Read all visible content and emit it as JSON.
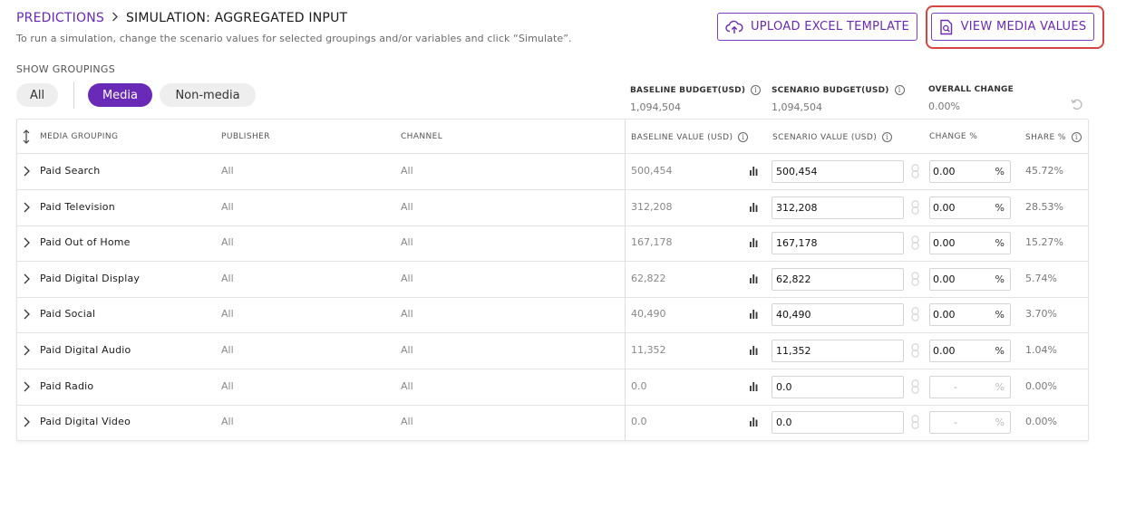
{
  "header": {
    "breadcrumb_root": "PREDICTIONS",
    "breadcrumb_current": "SIMULATION: AGGREGATED INPUT",
    "subtitle": "To run a simulation, change the scenario values for selected groupings and/or variables and click “Simulate”.",
    "upload_label": "UPLOAD EXCEL TEMPLATE",
    "view_label": "VIEW MEDIA VALUES"
  },
  "groupings": {
    "label": "SHOW GROUPINGS",
    "options": [
      "All",
      "Media",
      "Non-media"
    ],
    "selected": "Media"
  },
  "budget": {
    "baseline_label": "BASELINE BUDGET(USD)",
    "baseline_value": "1,094,504",
    "scenario_label": "SCENARIO BUDGET(USD)",
    "scenario_value": "1,094,504",
    "overall_label": "OVERALL CHANGE",
    "overall_value": "0.00%"
  },
  "table": {
    "columns": {
      "grouping": "MEDIA GROUPING",
      "publisher": "PUBLISHER",
      "channel": "CHANNEL",
      "baseline": "BASELINE VALUE (USD)",
      "scenario": "SCENARIO VALUE (USD)",
      "change": "CHANGE %",
      "share": "SHARE %"
    },
    "rows": [
      {
        "name": "Paid Search",
        "publisher": "All",
        "channel": "All",
        "baseline": "500,454",
        "scenario": "500,454",
        "change": "0.00",
        "change_enabled": true,
        "share": "45.72%"
      },
      {
        "name": "Paid Television",
        "publisher": "All",
        "channel": "All",
        "baseline": "312,208",
        "scenario": "312,208",
        "change": "0.00",
        "change_enabled": true,
        "share": "28.53%"
      },
      {
        "name": "Paid Out of Home",
        "publisher": "All",
        "channel": "All",
        "baseline": "167,178",
        "scenario": "167,178",
        "change": "0.00",
        "change_enabled": true,
        "share": "15.27%"
      },
      {
        "name": "Paid Digital Display",
        "publisher": "All",
        "channel": "All",
        "baseline": "62,822",
        "scenario": "62,822",
        "change": "0.00",
        "change_enabled": true,
        "share": "5.74%"
      },
      {
        "name": "Paid Social",
        "publisher": "All",
        "channel": "All",
        "baseline": "40,490",
        "scenario": "40,490",
        "change": "0.00",
        "change_enabled": true,
        "share": "3.70%"
      },
      {
        "name": "Paid Digital Audio",
        "publisher": "All",
        "channel": "All",
        "baseline": "11,352",
        "scenario": "11,352",
        "change": "0.00",
        "change_enabled": true,
        "share": "1.04%"
      },
      {
        "name": "Paid Radio",
        "publisher": "All",
        "channel": "All",
        "baseline": "0.0",
        "scenario": "0.0",
        "change": "-",
        "change_enabled": false,
        "share": "0.00%"
      },
      {
        "name": "Paid Digital Video",
        "publisher": "All",
        "channel": "All",
        "baseline": "0.0",
        "scenario": "0.0",
        "change": "-",
        "change_enabled": false,
        "share": "0.00%"
      }
    ],
    "percent_symbol": "%"
  },
  "colors": {
    "accent": "#6a2ab8",
    "highlight_ring": "#d64541"
  },
  "icons": [
    "chevron-right-icon",
    "upload-cloud-icon",
    "document-search-icon",
    "info-icon",
    "undo-icon",
    "sort-icon",
    "bar-chart-icon",
    "link-icon"
  ]
}
